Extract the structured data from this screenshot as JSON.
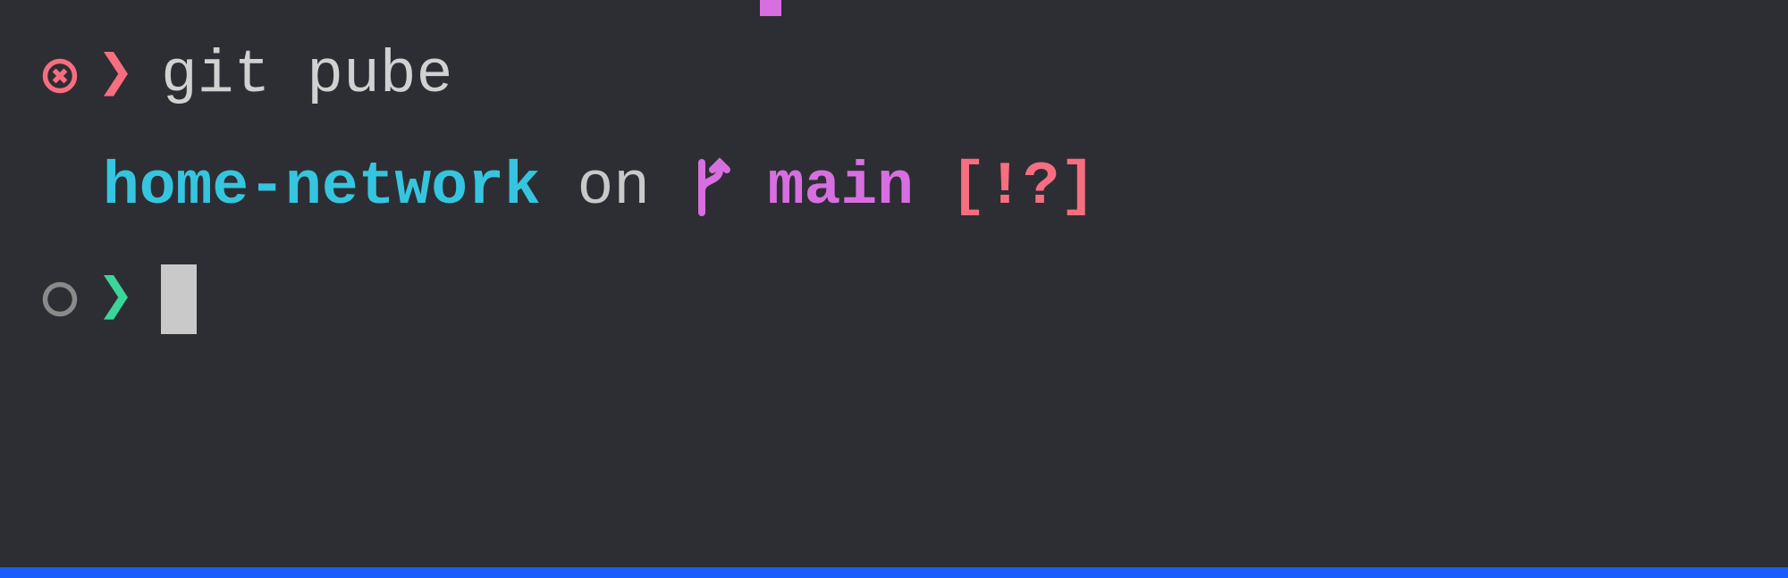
{
  "lines": {
    "prev_command": {
      "status": "error",
      "prompt_symbol": "❯",
      "command": "git pube"
    },
    "context": {
      "cwd": "home-network",
      "on": " on ",
      "branch": "main",
      "dirty": "[!?]"
    },
    "current": {
      "status": "ok",
      "prompt_symbol": "❯"
    }
  },
  "colors": {
    "error": "#f76e80",
    "ok": "#3ad59b",
    "cwd": "#35c5df",
    "branch": "#d76fe0",
    "text": "#d1d1d1",
    "accent_bar": "#175dff"
  }
}
